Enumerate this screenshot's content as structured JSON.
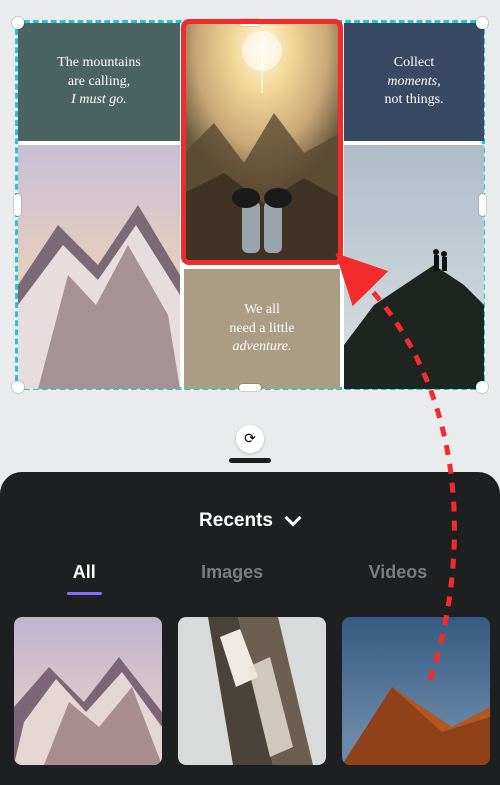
{
  "collage": {
    "tiles": {
      "a": {
        "line1": "The mountains",
        "line2": "are calling,",
        "line3_em": "I must go."
      },
      "c": {
        "line1": "Collect",
        "line2_em": "moments,",
        "line3": "not things."
      },
      "e": {
        "line1": "We all",
        "line2": "need a little",
        "line3_em": "adventure."
      }
    },
    "selected_tile": "b"
  },
  "controls": {
    "rotate_glyph": "⟳"
  },
  "picker": {
    "header_label": "Recents",
    "tabs": {
      "all": "All",
      "images": "Images",
      "videos": "Videos"
    },
    "active_tab": "all"
  }
}
